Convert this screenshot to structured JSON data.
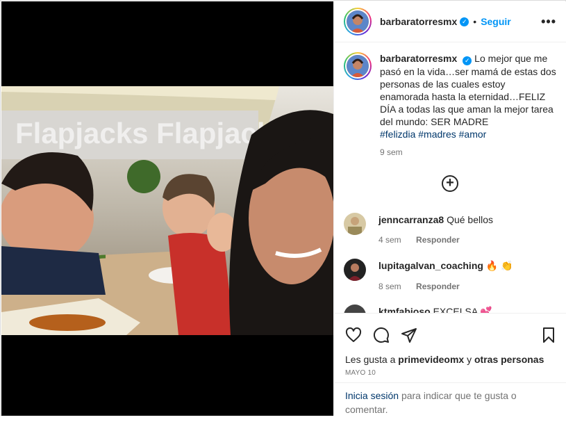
{
  "post": {
    "username": "barbaratorresmx",
    "follow_label": "Seguir",
    "separator": "•",
    "more_label": "•••",
    "verified_glyph": "✓",
    "caption": {
      "username": "barbaratorresmx",
      "text": "Lo mejor que me pasó en la vida…ser mamá de estas dos personas de las cuales estoy enamorada hasta la eternidad…FELIZ DÍA a todas las que aman la mejor tarea del mundo: SER MADRE",
      "hashtags": [
        "#felizdia",
        "#madres",
        "#amor"
      ],
      "time": "9 sem"
    },
    "load_more_glyph": "+",
    "photo_sign_text": "Flapjacks  Flapjacks"
  },
  "comments": [
    {
      "username": "jenncarranza8",
      "text": "Qué bellos",
      "time": "4 sem",
      "reply": "Responder"
    },
    {
      "username": "lupitagalvan_coaching",
      "text": "🔥 👏",
      "time": "8 sem",
      "reply": "Responder"
    },
    {
      "username": "ktmfabioso",
      "text": "EXCELSA 💕"
    }
  ],
  "actions": {
    "icons": [
      "heart-icon",
      "comment-icon",
      "share-icon",
      "bookmark-icon"
    ],
    "likes_prefix": "Les gusta a",
    "likes_user": "primevideomx",
    "likes_connector": "y",
    "likes_others": "otras personas",
    "date": "MAYO 10"
  },
  "login": {
    "link": "Inicia sesión",
    "text": "para indicar que te gusta o comentar."
  },
  "colors": {
    "accent": "#0095f6",
    "hashtag": "#00376b",
    "muted": "#737373"
  }
}
